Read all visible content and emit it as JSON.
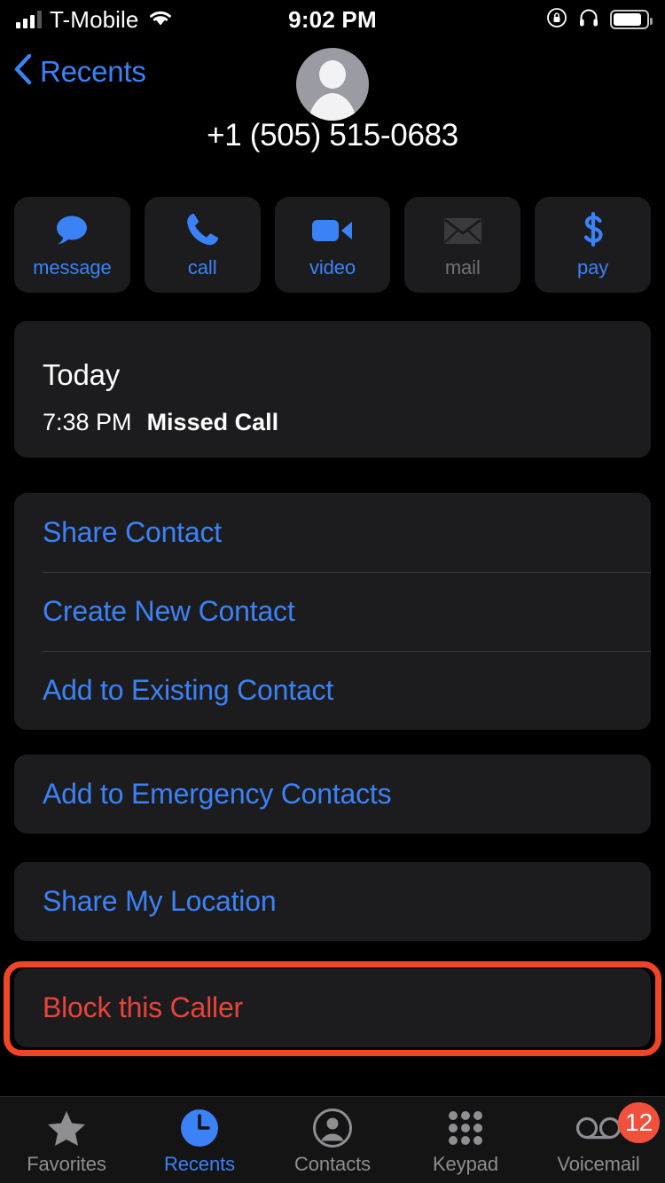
{
  "status_bar": {
    "carrier": "T-Mobile",
    "time": "9:02 PM",
    "icons": [
      "signal-icon",
      "wifi-icon",
      "rotation-lock-icon",
      "headphones-icon",
      "battery-icon"
    ]
  },
  "nav": {
    "back_label": "Recents",
    "back_icon": "chevron-left-icon",
    "avatar_icon": "person-placeholder-avatar"
  },
  "contact": {
    "phone_number": "+1 (505) 515-0683"
  },
  "quick_actions": [
    {
      "label": "message",
      "icon": "message-bubble-icon",
      "enabled": true
    },
    {
      "label": "call",
      "icon": "phone-handset-icon",
      "enabled": true
    },
    {
      "label": "video",
      "icon": "video-camera-icon",
      "enabled": true
    },
    {
      "label": "mail",
      "icon": "envelope-icon",
      "enabled": false
    },
    {
      "label": "pay",
      "icon": "dollar-sign-icon",
      "enabled": true
    }
  ],
  "call_history": {
    "day": "Today",
    "time": "7:38 PM",
    "type": "Missed Call"
  },
  "contact_actions": [
    {
      "label": "Share Contact"
    },
    {
      "label": "Create New Contact"
    },
    {
      "label": "Add to Existing Contact"
    }
  ],
  "emergency_action": {
    "label": "Add to Emergency Contacts"
  },
  "location_action": {
    "label": "Share My Location"
  },
  "block_action": {
    "label": "Block this Caller",
    "color": "#e8443a",
    "highlighted": true
  },
  "annotation": {
    "color": "#f04526"
  },
  "tabs": [
    {
      "label": "Favorites",
      "icon": "star-icon",
      "active": false,
      "badge": null
    },
    {
      "label": "Recents",
      "icon": "clock-icon",
      "active": true,
      "badge": null
    },
    {
      "label": "Contacts",
      "icon": "person-circle-icon",
      "active": false,
      "badge": null
    },
    {
      "label": "Keypad",
      "icon": "keypad-grid-icon",
      "active": false,
      "badge": null
    },
    {
      "label": "Voicemail",
      "icon": "voicemail-icon",
      "active": false,
      "badge": "12"
    }
  ],
  "colors": {
    "accent_blue": "#3b82f6",
    "destructive_red": "#e8443a",
    "badge_red": "#f0503c",
    "card_bg": "#1c1c1e",
    "screen_bg": "#000000"
  }
}
